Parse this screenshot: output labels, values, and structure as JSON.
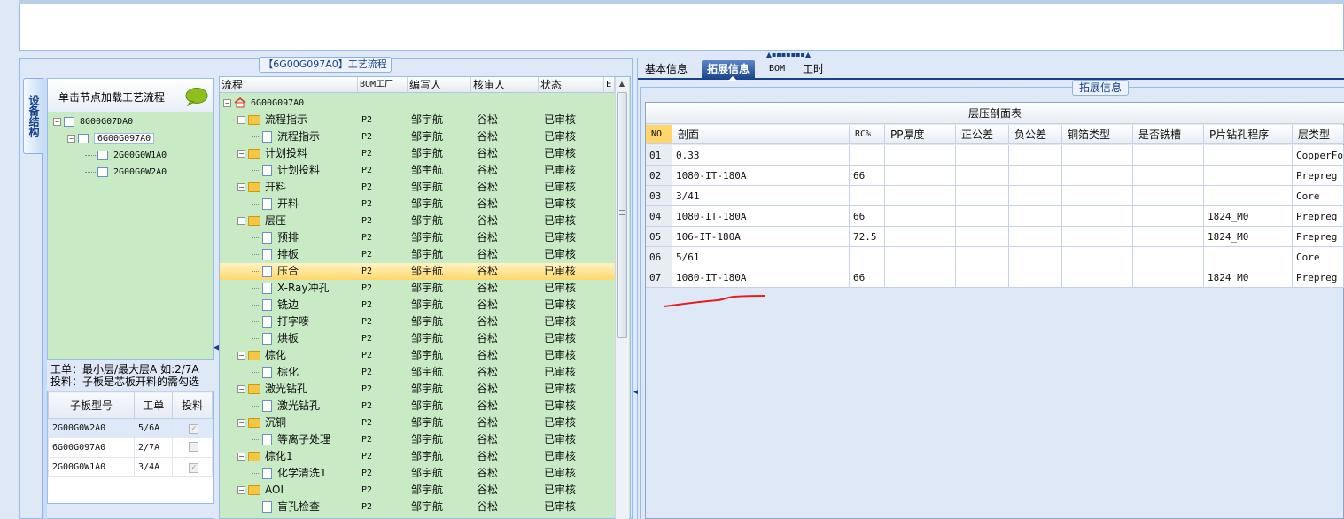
{
  "left_group": {
    "caption": "【6G00G097A0】工艺流程"
  },
  "vertical_tab": {
    "label": "设备结构"
  },
  "device_panel": {
    "header": "单击节点加载工艺流程",
    "nodes": [
      {
        "label": "8G00G07DA0",
        "toggle": "−"
      },
      {
        "label": "6G00G097A0",
        "toggle": "−"
      },
      {
        "label": "2G00G0W1A0"
      },
      {
        "label": "2G00G0W2A0"
      }
    ]
  },
  "info": {
    "line1": "工单：最小层/最大层A 如:2/7A",
    "line2": "投料：子板是芯板开料的需勾选"
  },
  "sub_table": {
    "headers": [
      "子板型号",
      "工单",
      "投料"
    ],
    "rows": [
      {
        "model": "2G00G0W2A0",
        "order": "5/6A",
        "checked": "✓"
      },
      {
        "model": "6G00G097A0",
        "order": "2/7A",
        "checked": ""
      },
      {
        "model": "2G00G0W1A0",
        "order": "3/4A",
        "checked": "✓"
      }
    ]
  },
  "process_grid": {
    "headers": [
      "流程",
      "BOM工厂",
      "编写人",
      "核审人",
      "状态",
      "E"
    ],
    "root": "6G00G097A0",
    "rows": [
      {
        "name": "流程指示",
        "folder": true,
        "factory": "P2",
        "writer": "邹宇航",
        "reviewer": "谷松",
        "status": "已审核"
      },
      {
        "name": "流程指示",
        "folder": false,
        "factory": "P2",
        "writer": "邹宇航",
        "reviewer": "谷松",
        "status": "已审核"
      },
      {
        "name": "计划投料",
        "folder": true,
        "factory": "P2",
        "writer": "邹宇航",
        "reviewer": "谷松",
        "status": "已审核"
      },
      {
        "name": "计划投料",
        "folder": false,
        "factory": "P2",
        "writer": "邹宇航",
        "reviewer": "谷松",
        "status": "已审核"
      },
      {
        "name": "开料",
        "folder": true,
        "factory": "P2",
        "writer": "邹宇航",
        "reviewer": "谷松",
        "status": "已审核"
      },
      {
        "name": "开料",
        "folder": false,
        "factory": "P2",
        "writer": "邹宇航",
        "reviewer": "谷松",
        "status": "已审核"
      },
      {
        "name": "层压",
        "folder": true,
        "factory": "P2",
        "writer": "邹宇航",
        "reviewer": "谷松",
        "status": "已审核"
      },
      {
        "name": "预排",
        "folder": false,
        "factory": "P2",
        "writer": "邹宇航",
        "reviewer": "谷松",
        "status": "已审核"
      },
      {
        "name": "排板",
        "folder": false,
        "factory": "P2",
        "writer": "邹宇航",
        "reviewer": "谷松",
        "status": "已审核"
      },
      {
        "name": "压合",
        "folder": false,
        "factory": "P2",
        "writer": "邹宇航",
        "reviewer": "谷松",
        "status": "已审核",
        "selected": true
      },
      {
        "name": "X-Ray冲孔",
        "folder": false,
        "factory": "P2",
        "writer": "邹宇航",
        "reviewer": "谷松",
        "status": "已审核"
      },
      {
        "name": "铣边",
        "folder": false,
        "factory": "P2",
        "writer": "邹宇航",
        "reviewer": "谷松",
        "status": "已审核"
      },
      {
        "name": "打字嘜",
        "folder": false,
        "factory": "P2",
        "writer": "邹宇航",
        "reviewer": "谷松",
        "status": "已审核"
      },
      {
        "name": "烘板",
        "folder": false,
        "factory": "P2",
        "writer": "邹宇航",
        "reviewer": "谷松",
        "status": "已审核"
      },
      {
        "name": "棕化",
        "folder": true,
        "factory": "P2",
        "writer": "邹宇航",
        "reviewer": "谷松",
        "status": "已审核"
      },
      {
        "name": "棕化",
        "folder": false,
        "factory": "P2",
        "writer": "邹宇航",
        "reviewer": "谷松",
        "status": "已审核"
      },
      {
        "name": "激光钻孔",
        "folder": true,
        "factory": "P2",
        "writer": "邹宇航",
        "reviewer": "谷松",
        "status": "已审核"
      },
      {
        "name": "激光钻孔",
        "folder": false,
        "factory": "P2",
        "writer": "邹宇航",
        "reviewer": "谷松",
        "status": "已审核"
      },
      {
        "name": "沉铜",
        "folder": true,
        "factory": "P2",
        "writer": "邹宇航",
        "reviewer": "谷松",
        "status": "已审核"
      },
      {
        "name": "等离子处理",
        "folder": false,
        "factory": "P2",
        "writer": "邹宇航",
        "reviewer": "谷松",
        "status": "已审核"
      },
      {
        "name": "棕化1",
        "folder": true,
        "factory": "P2",
        "writer": "邹宇航",
        "reviewer": "谷松",
        "status": "已审核"
      },
      {
        "name": "化学清洗1",
        "folder": false,
        "factory": "P2",
        "writer": "邹宇航",
        "reviewer": "谷松",
        "status": "已审核"
      },
      {
        "name": "AOI",
        "folder": true,
        "factory": "P2",
        "writer": "邹宇航",
        "reviewer": "谷松",
        "status": "已审核"
      },
      {
        "name": "盲孔检查",
        "folder": false,
        "factory": "P2",
        "writer": "邹宇航",
        "reviewer": "谷松",
        "status": "已审核"
      }
    ]
  },
  "tabs": [
    "基本信息",
    "拓展信息",
    "BOM",
    "工时"
  ],
  "active_tab": "拓展信息",
  "ext_panel": {
    "caption": "拓展信息"
  },
  "layer_table": {
    "title": "层压剖面表",
    "headers": [
      "NO",
      "剖面",
      "RC%",
      "PP厚度",
      "正公差",
      "负公差",
      "铜箔类型",
      "是否铣槽",
      "P片钻孔程序",
      "层类型"
    ],
    "rows": [
      [
        "01",
        "0.33",
        "",
        "",
        "",
        "",
        "",
        "",
        "",
        "CopperFoil"
      ],
      [
        "02",
        "1080-IT-180A",
        "66",
        "",
        "",
        "",
        "",
        "",
        "",
        "Prepreg"
      ],
      [
        "03",
        "3/41",
        "",
        "",
        "",
        "",
        "",
        "",
        "",
        "Core"
      ],
      [
        "04",
        "1080-IT-180A",
        "66",
        "",
        "",
        "",
        "",
        "",
        "1824_M0",
        "Prepreg"
      ],
      [
        "05",
        "106-IT-180A",
        "72.5",
        "",
        "",
        "",
        "",
        "",
        "1824_M0",
        "Prepreg"
      ],
      [
        "06",
        "5/61",
        "",
        "",
        "",
        "",
        "",
        "",
        "",
        "Core"
      ],
      [
        "07",
        "1080-IT-180A",
        "66",
        "",
        "",
        "",
        "",
        "",
        "1824_M0",
        "Prepreg"
      ]
    ]
  },
  "colors": {
    "panel_bg": "#dfe8f6",
    "tree_bg": "#c8ebc6",
    "accent": "#15428b",
    "highlight": "#ffd86b",
    "annotation_red": "#e02020"
  }
}
